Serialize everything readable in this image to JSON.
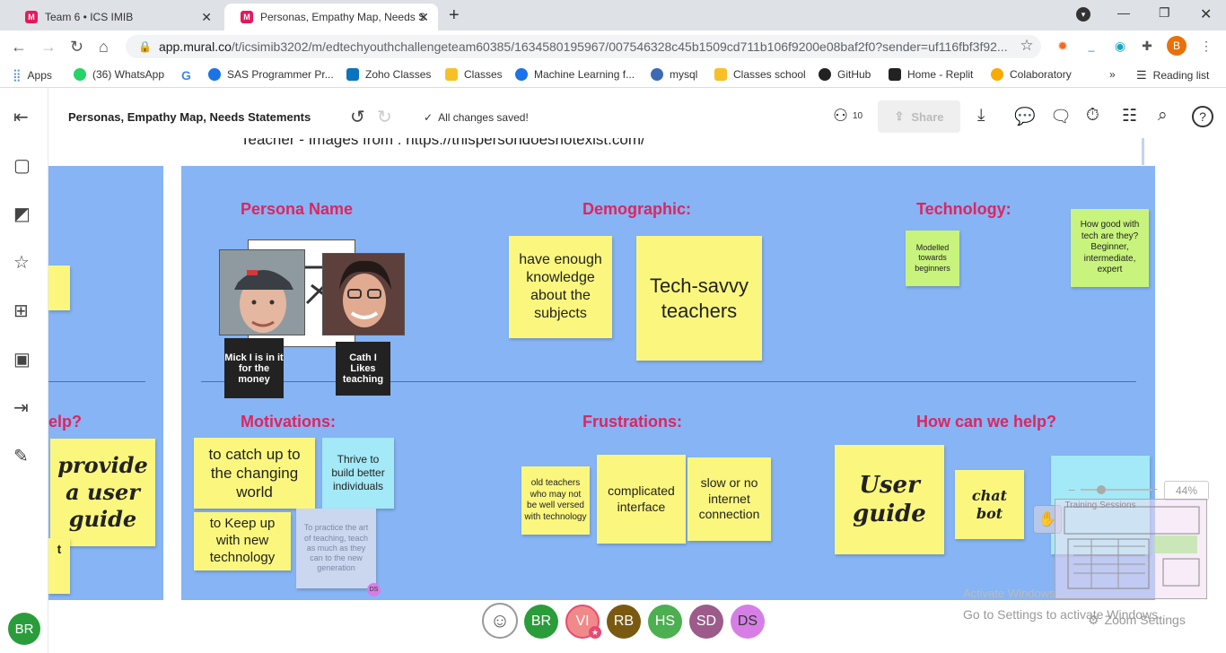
{
  "browser": {
    "tabs": [
      {
        "label": "Team 6 • ICS IMIB"
      },
      {
        "label": "Personas, Empathy Map, Needs S"
      }
    ],
    "url_host": "app.mural.co",
    "url_path": "/t/icsimib3202/m/edtechyouthchallengeteam60385/1634580195967/007546328c45b1509cd711b106f9200e08baf2f0?sender=uf116fbf3f92...",
    "profile_initial": "B",
    "bookmarks": [
      {
        "label": "Apps",
        "color": "#4285f4"
      },
      {
        "label": "(36) WhatsApp",
        "color": "#25d366"
      },
      {
        "label": "G",
        "color": "#ffffff"
      },
      {
        "label": "SAS Programmer Pr...",
        "color": "#1a73e8"
      },
      {
        "label": "Zoho Classes",
        "color": "#0b74c1"
      },
      {
        "label": "Classes",
        "color": "#f6c026"
      },
      {
        "label": "Machine Learning f...",
        "color": "#1a73e8"
      },
      {
        "label": "mysql",
        "color": "#3d6bb3"
      },
      {
        "label": "Classes school",
        "color": "#f6c026"
      },
      {
        "label": "GitHub",
        "color": "#222222"
      },
      {
        "label": "Home - Replit",
        "color": "#222222"
      },
      {
        "label": "Colaboratory",
        "color": "#f9ab00"
      }
    ],
    "reading_list": "Reading list",
    "more": "»"
  },
  "mural": {
    "title": "Personas, Empathy Map, Needs Statements",
    "save_status": "All changes saved!",
    "collaborators_count": "10",
    "share_label": "Share",
    "user_initials": "BR"
  },
  "canvas": {
    "top_text": "Teacher - Images from : https://thispersondoesnotexist.com/",
    "left_panel": {
      "help_partial": "elp?",
      "provide_sticky": "provide a user guide",
      "t_partial": "t"
    },
    "sections": {
      "persona_name": "Persona Name",
      "demographic": "Demographic:",
      "technology": "Technology:",
      "motivations": "Motivations:",
      "frustrations": "Frustrations:",
      "how_help": "How can we help?"
    },
    "personas": [
      {
        "name": "Mick I is in it for the money"
      },
      {
        "name": "Cath I Likes teaching"
      }
    ],
    "stickies": {
      "demo_1": "have enough knowledge about the subjects",
      "demo_2": "Tech-savvy teachers",
      "tech_1": "Modelled towards beginners",
      "tech_2": "How good with tech are they? Beginner, intermediate, expert",
      "mot_1": "to catch up to the changing world",
      "mot_2": "Thrive to build better individuals",
      "mot_3": "to Keep up with new technology",
      "mot_4": "To practice the art of teaching, teach as much as they can to the new generation",
      "mot_4_badge": "DS",
      "frus_1": "old teachers who may not be well versed with technology",
      "frus_2": "complicated interface",
      "frus_3": "slow or no internet connection",
      "help_1": "User guide",
      "help_2": "chat bot",
      "help_3": "Training Sessions"
    }
  },
  "presence": [
    {
      "initials": "BR",
      "color": "#2a9d3a"
    },
    {
      "initials": "VI",
      "color": "#f08a8a"
    },
    {
      "initials": "RB",
      "color": "#7a5a10"
    },
    {
      "initials": "HS",
      "color": "#4caf50"
    },
    {
      "initials": "SD",
      "color": "#9c5b8a"
    },
    {
      "initials": "DS",
      "color": "#d67ee6"
    }
  ],
  "overlay": {
    "zoom": "44%",
    "zoom_settings": "Zoom Settings",
    "activate_line1": "Activate Windows",
    "activate_line2": "Go to Settings to activate Windows."
  }
}
